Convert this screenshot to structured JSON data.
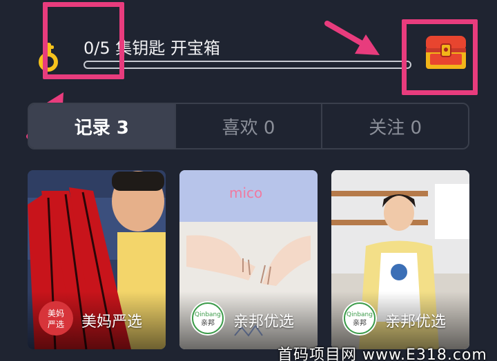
{
  "progress": {
    "text": "0/5 集钥匙 开宝箱",
    "collected": 0,
    "total": 5,
    "fill_fraction": 0
  },
  "icons": {
    "key": "key-icon",
    "chest": "treasure-chest-icon"
  },
  "tabs": [
    {
      "label": "记录 3",
      "active": true
    },
    {
      "label": "喜欢 0",
      "active": false
    },
    {
      "label": "关注 0",
      "active": false
    }
  ],
  "cards": [
    {
      "shop_name": "美妈严选",
      "avatar_text_1": "美妈",
      "avatar_text_2": "严选"
    },
    {
      "shop_name": "亲邦优选",
      "avatar_text_1": "Qinbang",
      "avatar_text_2": "亲邦",
      "art_text": "mico"
    },
    {
      "shop_name": "亲邦优选",
      "avatar_text_1": "Qinbang",
      "avatar_text_2": "亲邦"
    }
  ],
  "watermark": "首码项目网 www.E318.com",
  "colors": {
    "background": "#1f2431",
    "highlight": "#e83c7d",
    "key_yellow": "#f6c21c",
    "chest_red": "#e8452f",
    "tab_active_bg": "#3c4150"
  }
}
